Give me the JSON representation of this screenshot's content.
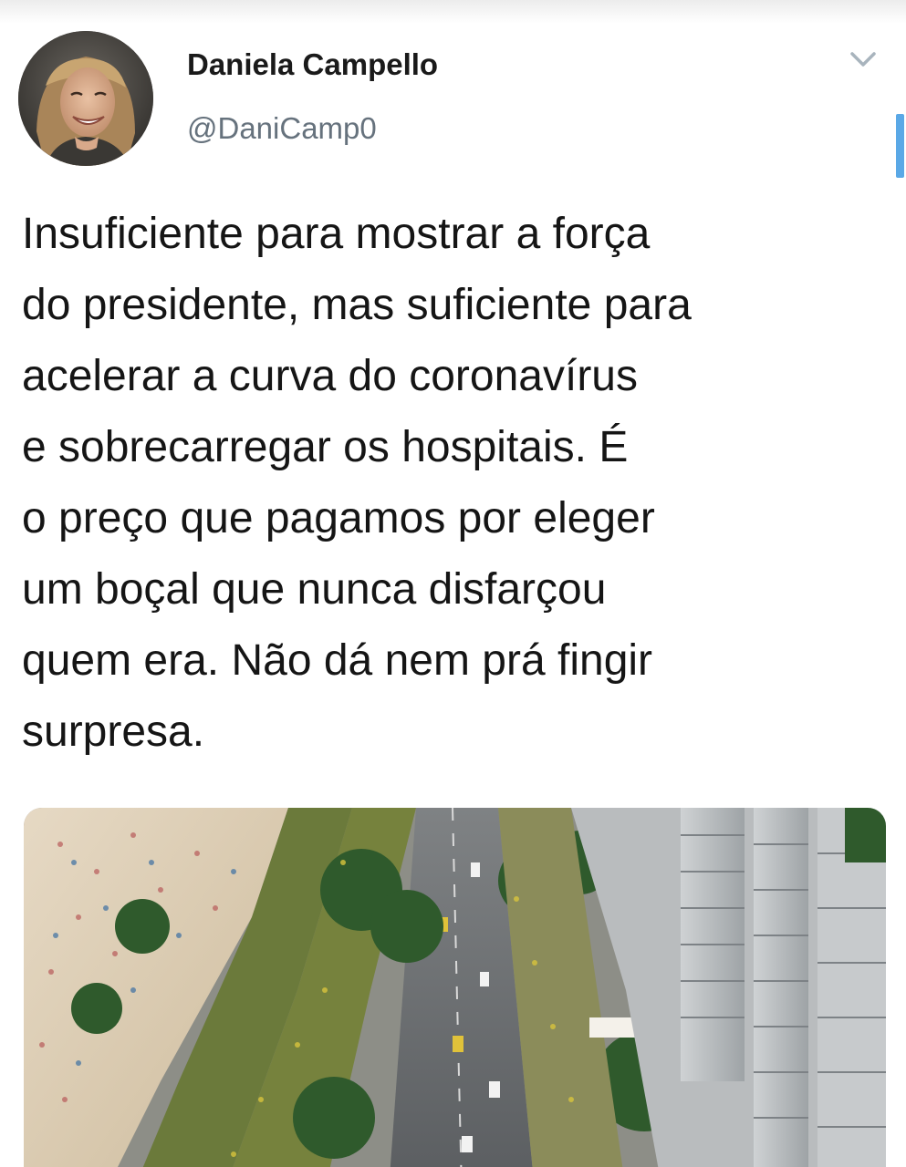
{
  "tweet": {
    "author": {
      "display_name": "Daniela Campello",
      "handle": "@DaniCamp0"
    },
    "text_lines": [
      "Insuficiente para mostrar a força",
      "do presidente, mas suficiente para",
      "acelerar a curva do coronavírus",
      "e sobrecarregar os hospitais. É",
      "o preço que pagamos por eleger",
      "um boçal que nunca disfarçou",
      "quem era. Não dá nem prá fingir",
      "surpresa."
    ],
    "menu_icon": "chevron-down-icon",
    "media_description_icon": "photo"
  },
  "colors": {
    "text": "#151515",
    "handle": "#66727d",
    "scroll_indicator": "#5aa8e6",
    "chevron": "#a8b4bd"
  }
}
